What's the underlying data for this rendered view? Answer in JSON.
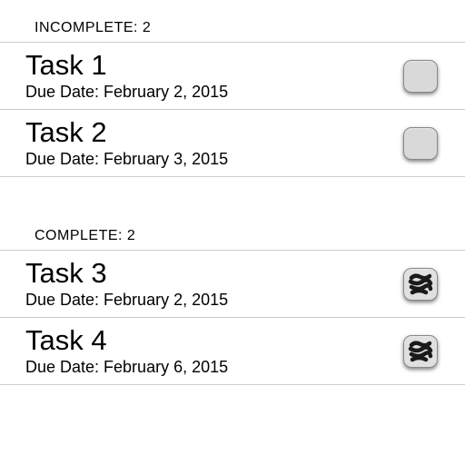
{
  "sections": {
    "incomplete": {
      "header": "INCOMPLETE: 2",
      "tasks": [
        {
          "title": "Task 1",
          "due": "Due Date: February 2, 2015",
          "checked": false
        },
        {
          "title": "Task 2",
          "due": "Due Date: February 3, 2015",
          "checked": false
        }
      ]
    },
    "complete": {
      "header": "COMPLETE: 2",
      "tasks": [
        {
          "title": "Task 3",
          "due": "Due Date: February 2, 2015",
          "checked": true
        },
        {
          "title": "Task 4",
          "due": "Due Date: February 6, 2015",
          "checked": true
        }
      ]
    }
  }
}
